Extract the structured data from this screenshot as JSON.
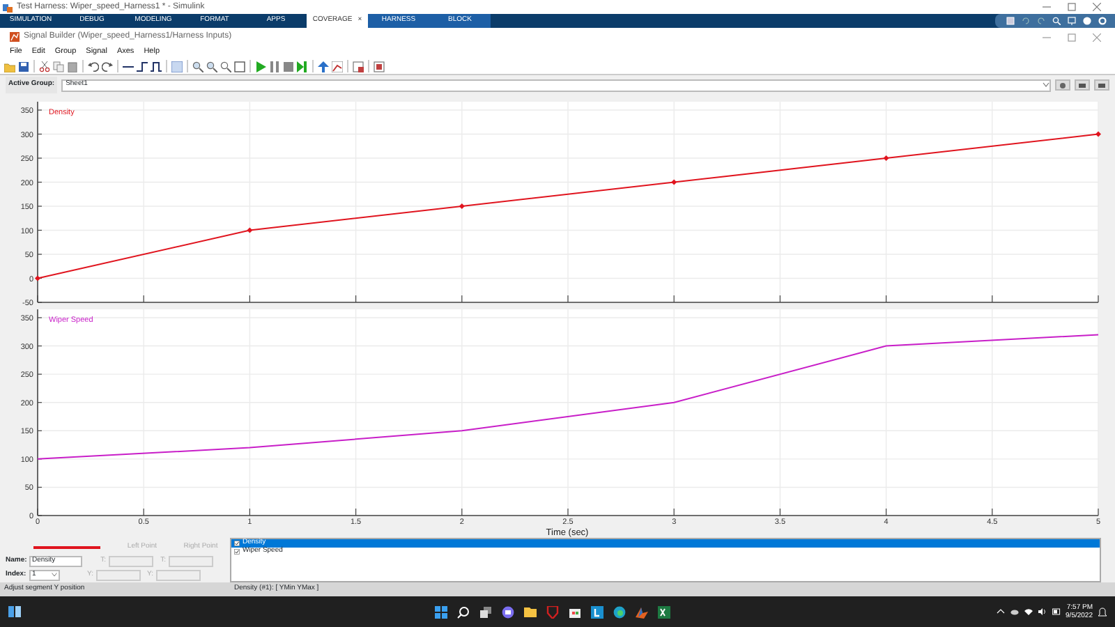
{
  "window": {
    "title": "Test Harness: Wiper_speed_Harness1 * - Simulink"
  },
  "ribbon_tabs": [
    {
      "label": "SIMULATION",
      "selected": false,
      "kind": "standard"
    },
    {
      "label": "DEBUG",
      "selected": false,
      "kind": "standard"
    },
    {
      "label": "MODELING",
      "selected": false,
      "kind": "standard"
    },
    {
      "label": "FORMAT",
      "selected": false,
      "kind": "standard"
    },
    {
      "label": "APPS",
      "selected": false,
      "kind": "standard"
    },
    {
      "label": "COVERAGE",
      "selected": true,
      "kind": "standard",
      "close": "×"
    },
    {
      "label": "HARNESS",
      "selected": false,
      "kind": "contextual"
    },
    {
      "label": "BLOCK",
      "selected": false,
      "kind": "contextual"
    }
  ],
  "dialog": {
    "title": "Signal Builder (Wiper_speed_Harness1/Harness Inputs)",
    "menu": [
      "File",
      "Edit",
      "Group",
      "Signal",
      "Axes",
      "Help"
    ]
  },
  "active_group": {
    "label": "Active Group:",
    "value": "Sheet1"
  },
  "axes": [
    {
      "chart_data": {
        "type": "line",
        "x": [
          0,
          1,
          2,
          3,
          4,
          5
        ],
        "series": [
          {
            "name": "Density",
            "color": "#e0141e",
            "marker": "diamond",
            "values": [
              0,
              100,
              150,
              200,
              250,
              300
            ]
          }
        ],
        "xlim": [
          0,
          5
        ],
        "ylim": [
          -50,
          350
        ],
        "yticks": [
          -50,
          0,
          50,
          100,
          150,
          200,
          250,
          300,
          350
        ],
        "grid": true
      }
    },
    {
      "chart_data": {
        "type": "line",
        "xlabel": "Time (sec)",
        "x": [
          0,
          1,
          2,
          3,
          4,
          5
        ],
        "series": [
          {
            "name": "Wiper Speed",
            "color": "#c81ec8",
            "values": [
              100,
              120,
              150,
              200,
              300,
              320
            ]
          }
        ],
        "xlim": [
          0,
          5
        ],
        "ylim": [
          0,
          350
        ],
        "xticks": [
          0,
          0.5,
          1,
          1.5,
          2,
          2.5,
          3,
          3.5,
          4,
          4.5,
          5
        ],
        "yticks": [
          0,
          50,
          100,
          150,
          200,
          250,
          300,
          350
        ],
        "grid": true
      }
    }
  ],
  "signal_editor": {
    "name_label": "Name:",
    "name_value": "Density",
    "index_label": "Index:",
    "index_value": "1",
    "points": [
      {
        "heading": "Left Point",
        "disabled": true,
        "fields": [
          "T:",
          "Y:"
        ]
      },
      {
        "heading": "Right Point",
        "disabled": true,
        "fields": [
          "T:",
          "Y:"
        ]
      }
    ]
  },
  "signals": [
    {
      "name": "Density",
      "checked": true,
      "selected": true
    },
    {
      "name": "Wiper Speed",
      "checked": true,
      "selected": false
    }
  ],
  "status_bar": [
    "Adjust segment Y position",
    "Density (#1): [ YMin YMax ]"
  ],
  "taskbar": {
    "time": "7:57 PM",
    "date": "9/5/2022"
  }
}
